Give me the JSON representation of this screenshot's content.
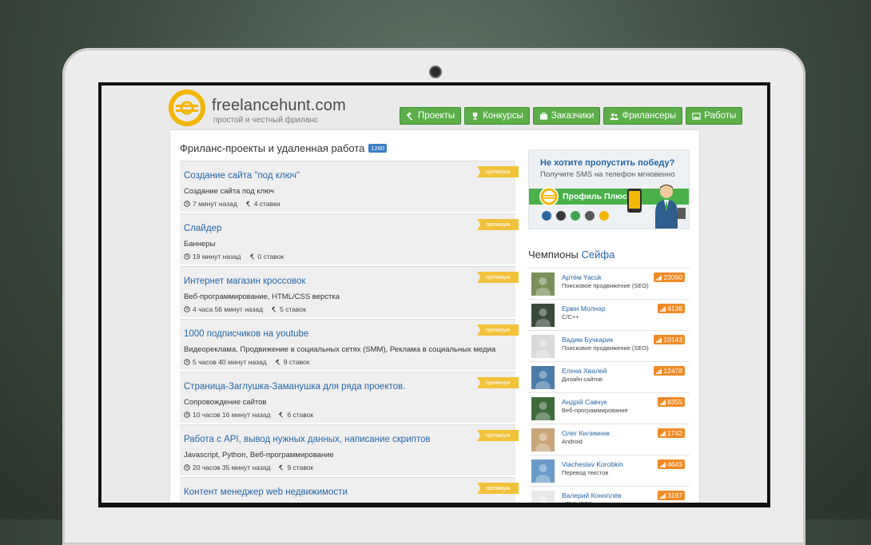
{
  "brand": {
    "name": "freelancehunt.com",
    "tagline": "простой и честный фриланс"
  },
  "nav": [
    {
      "label": "Проекты",
      "icon": "gavel-icon"
    },
    {
      "label": "Конкурсы",
      "icon": "trophy-icon"
    },
    {
      "label": "Заказчики",
      "icon": "briefcase-icon"
    },
    {
      "label": "Фрилансеры",
      "icon": "users-icon"
    },
    {
      "label": "Работы",
      "icon": "image-icon"
    }
  ],
  "page": {
    "title": "Фриланс-проекты и удаленная работа",
    "count": "1280"
  },
  "ribbon_label": "премиум",
  "projects": [
    {
      "title": "Создание сайта \"под ключ\"",
      "category": "Создание сайта под ключ",
      "time": "7 минут назад",
      "bids": "4 ставки"
    },
    {
      "title": "Слайдер",
      "category": "Баннеры",
      "time": "19 минут назад",
      "bids": "0 ставок"
    },
    {
      "title": "Интернет магазин кроссовок",
      "category": "Веб-программирование, HTML/CSS верстка",
      "time": "4 часа 56 минут назад",
      "bids": "5 ставок"
    },
    {
      "title": "1000 подписчиков на youtube",
      "category": "Видеореклама, Продвижение в социальных сетях (SMM), Реклама в социальных медиа",
      "time": "5 часов 40 минут назад",
      "bids": "9 ставок"
    },
    {
      "title": "Страница-Заглушка-Заманушка для ряда проектов.",
      "category": "Сопровождение сайтов",
      "time": "10 часов 16 минут назад",
      "bids": "6 ставок"
    },
    {
      "title": "Работа с API, вывод нужных данных, написание скриптов",
      "category": "Javascript, Python, Веб-программирование",
      "time": "20 часов 35 минут назад",
      "bids": "9 ставок"
    },
    {
      "title": "Контент менеджер web недвижимости",
      "category": "",
      "time": "",
      "bids": ""
    }
  ],
  "promo": {
    "title": "Не хотите пропустить победу?",
    "subtitle": "Получите SMS на телефон мгновенно",
    "band_label": "Профиль Плюс"
  },
  "champions": {
    "title_prefix": "Чемпионы",
    "title_accent": "Сейфа",
    "items": [
      {
        "name": "Артём Yacuk",
        "spec": "Поисковое продвижение (SEO)",
        "rating": "23090",
        "avatar_color": "#7a8f5a"
      },
      {
        "name": "Ервін Молнар",
        "spec": "C/C++",
        "rating": "4138",
        "avatar_color": "#3a4a3a"
      },
      {
        "name": "Вадим Бучкарик",
        "spec": "Поисковое продвижение (SEO)",
        "rating": "10143",
        "avatar_color": "#d9d9d9"
      },
      {
        "name": "Елена Хвалей",
        "spec": "Дизайн сайтов",
        "rating": "12478",
        "avatar_color": "#4b7ca8"
      },
      {
        "name": "Андрій Савчук",
        "spec": "Веб-программирование",
        "rating": "8355",
        "avatar_color": "#3d6b3a"
      },
      {
        "name": "Олег Килимник",
        "spec": "Android",
        "rating": "1742",
        "avatar_color": "#c9a57a"
      },
      {
        "name": "Viacheslav Korobkin",
        "spec": "Перевод текстов",
        "rating": "4643",
        "avatar_color": "#6a9bc8"
      },
      {
        "name": "Валерий Коноплёв",
        "spec": "HTML/CSS верстка",
        "rating": "3197",
        "avatar_color": "#e8e8e8"
      }
    ]
  },
  "colors": {
    "accent_green": "#5cae4a",
    "link_blue": "#2566a8",
    "ribbon_yellow": "#f2c23a",
    "rating_orange": "#f08a26",
    "logo_yellow": "#f2b705"
  }
}
